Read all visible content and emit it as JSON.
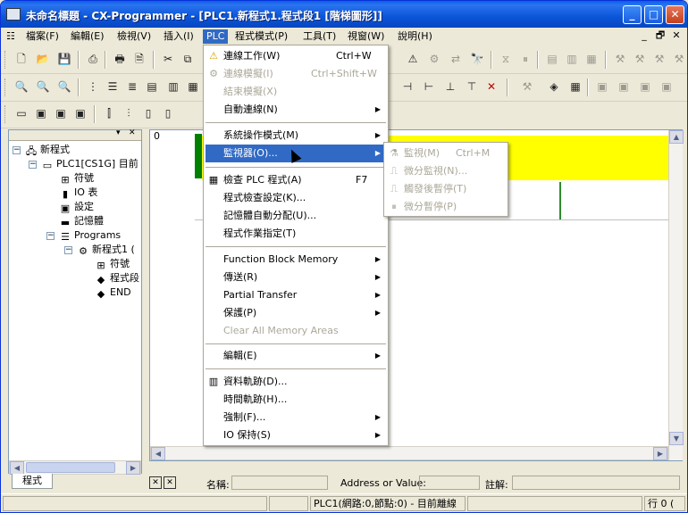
{
  "window": {
    "title": "未命名標題 - CX-Programmer - [PLC1.新程式1.程式段1 [階梯圖形]]"
  },
  "caption_buttons": {
    "minimize": "_",
    "maximize": "□",
    "close": "✕"
  },
  "menubar": {
    "items": [
      "檔案(F)",
      "編輯(E)",
      "檢視(V)",
      "插入(I)",
      "PLC",
      "程式模式(P)",
      "工具(T)",
      "視窗(W)",
      "說明(H)"
    ],
    "active": "PLC",
    "mdi_controls": [
      "_",
      "🗗",
      "✕"
    ]
  },
  "tree": {
    "root": "新程式",
    "plc": "PLC1[CS1G] 目前",
    "items": [
      "符號",
      "IO 表",
      "設定",
      "記憶體"
    ],
    "programs": "Programs",
    "program1": "新程式1 (",
    "program_items": [
      "符號",
      "程式段",
      "END"
    ],
    "tab": "程式"
  },
  "ladder": {
    "row_number": "0"
  },
  "plc_menu": {
    "items": [
      {
        "label": "連線工作(W)",
        "shortcut": "Ctrl+W",
        "icon": "warning-icon",
        "disabled": false,
        "submenu": false
      },
      {
        "label": "連線模擬(I)",
        "shortcut": "Ctrl+Shift+W",
        "icon": "simulator-icon",
        "disabled": true,
        "submenu": false
      },
      {
        "label": "結束模擬(X)",
        "shortcut": "",
        "icon": "",
        "disabled": true,
        "submenu": false
      },
      {
        "label": "自動連線(N)",
        "shortcut": "",
        "icon": "",
        "disabled": false,
        "submenu": true
      },
      {
        "label": "系統操作模式(M)",
        "shortcut": "",
        "icon": "",
        "disabled": false,
        "submenu": true
      },
      {
        "label": "監視器(O)...",
        "shortcut": "",
        "icon": "",
        "disabled": false,
        "submenu": true,
        "highlighted": true
      },
      {
        "label": "檢查 PLC 程式(A)",
        "shortcut": "F7",
        "icon": "check-program-icon",
        "disabled": false,
        "submenu": false
      },
      {
        "label": "程式檢查設定(K)...",
        "shortcut": "",
        "icon": "",
        "disabled": false,
        "submenu": false
      },
      {
        "label": "記憶體自動分配(U)...",
        "shortcut": "",
        "icon": "",
        "disabled": false,
        "submenu": false
      },
      {
        "label": "程式作業指定(T)",
        "shortcut": "",
        "icon": "",
        "disabled": false,
        "submenu": false
      },
      {
        "label": "Function Block Memory",
        "shortcut": "",
        "icon": "",
        "disabled": false,
        "submenu": true
      },
      {
        "label": "傳送(R)",
        "shortcut": "",
        "icon": "",
        "disabled": false,
        "submenu": true
      },
      {
        "label": "Partial Transfer",
        "shortcut": "",
        "icon": "",
        "disabled": false,
        "submenu": true
      },
      {
        "label": "保護(P)",
        "shortcut": "",
        "icon": "",
        "disabled": false,
        "submenu": true
      },
      {
        "label": "Clear All Memory Areas",
        "shortcut": "",
        "icon": "",
        "disabled": true,
        "submenu": false
      },
      {
        "label": "編輯(E)",
        "shortcut": "",
        "icon": "",
        "disabled": false,
        "submenu": true
      },
      {
        "label": "資料軌跡(D)...",
        "shortcut": "",
        "icon": "data-trace-icon",
        "disabled": false,
        "submenu": false
      },
      {
        "label": "時間軌跡(H)...",
        "shortcut": "",
        "icon": "",
        "disabled": false,
        "submenu": false
      },
      {
        "label": "強制(F)...",
        "shortcut": "",
        "icon": "",
        "disabled": false,
        "submenu": true
      },
      {
        "label": "IO 保持(S)",
        "shortcut": "",
        "icon": "",
        "disabled": false,
        "submenu": true
      }
    ]
  },
  "monitor_submenu": {
    "items": [
      {
        "label": "監視(M)",
        "shortcut": "Ctrl+M"
      },
      {
        "label": "微分監視(N)...",
        "shortcut": ""
      },
      {
        "label": "觸發後暫停(T)",
        "shortcut": ""
      },
      {
        "label": "微分暫停(P)",
        "shortcut": ""
      }
    ]
  },
  "statusrow": {
    "name_label": "名稱:",
    "address_label": "Address or Value:",
    "comment_label": "註解:"
  },
  "statusbar": {
    "connection": "PLC1(網路:0,節點:0) - 目前離線",
    "position": "行 0 ("
  }
}
